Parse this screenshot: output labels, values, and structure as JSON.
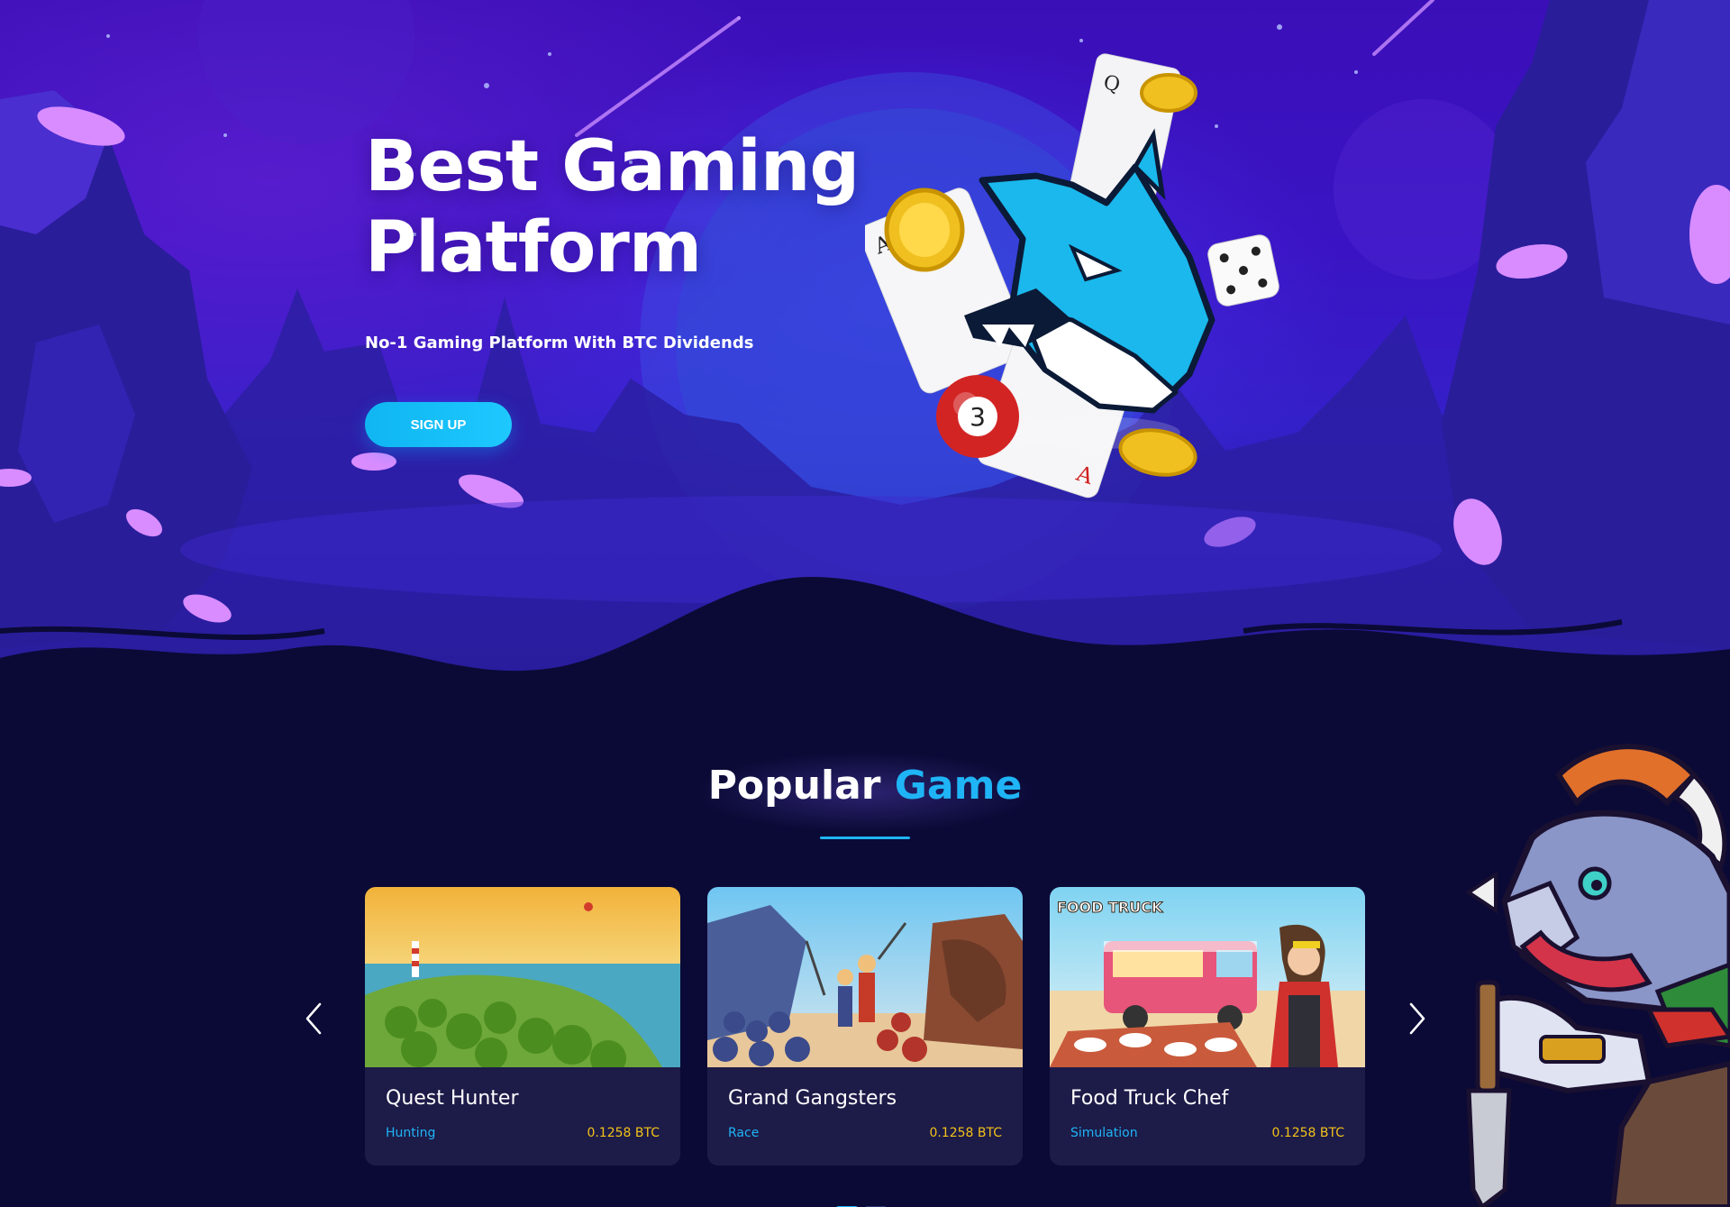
{
  "hero": {
    "title_line1": "Best Gaming",
    "title_line2": "Platform",
    "subtitle": "No-1 Gaming Platform With BTC Dividends",
    "signup_label": "SIGN UP",
    "mascot_ball_number": "3"
  },
  "popular": {
    "title_word1": "Popular",
    "title_word2": "Game",
    "prev_icon": "chevron-left-icon",
    "next_icon": "chevron-right-icon",
    "games": [
      {
        "name": "Quest Hunter",
        "genre": "Hunting",
        "price": "0.1258 BTC"
      },
      {
        "name": "Grand Gangsters",
        "genre": "Race",
        "price": "0.1258 BTC"
      },
      {
        "name": "Food Truck Chef",
        "genre": "Simulation",
        "price": "0.1258 BTC",
        "thumb_logo": "FOOD TRUCK"
      }
    ],
    "pagination": {
      "current": 1,
      "total": 2
    }
  },
  "colors": {
    "accent": "#1fb4f5",
    "price": "#f2c21a",
    "card_bg": "#1d1b48",
    "page_bg": "#0b0a36",
    "hero_purple": "#3a14c4"
  }
}
